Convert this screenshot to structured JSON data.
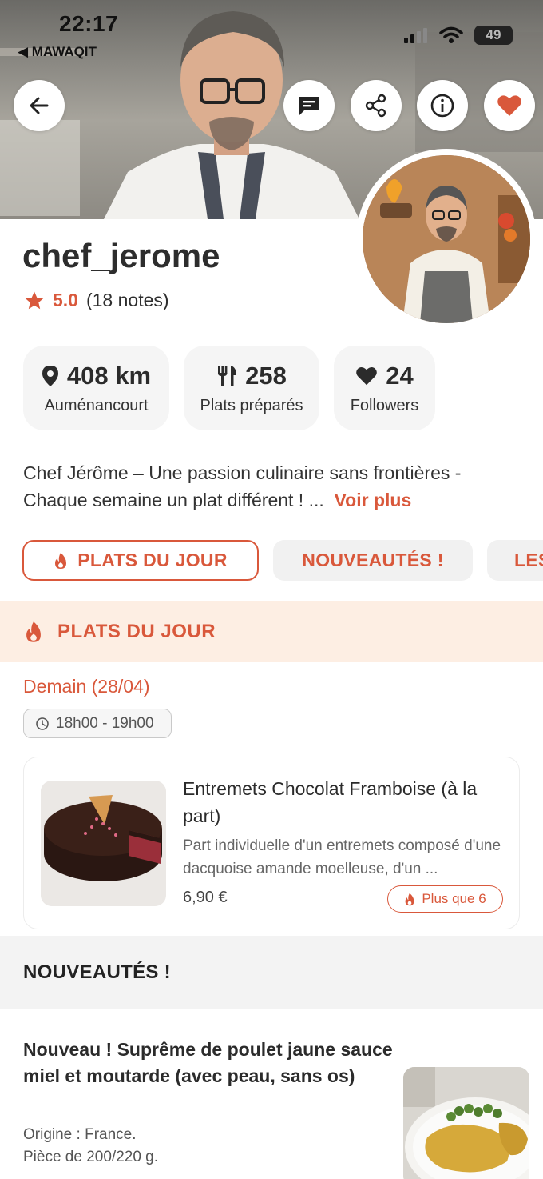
{
  "status_bar": {
    "time": "22:17",
    "back_app": "◀ MAWAQIT",
    "battery": "49"
  },
  "profile": {
    "username": "chef_jerome",
    "rating_score": "5.0",
    "rating_count": "(18 notes)"
  },
  "stats": [
    {
      "icon": "location-pin-icon",
      "value": "408 km",
      "label": "Auménancourt"
    },
    {
      "icon": "fork-knife-icon",
      "value": "258",
      "label": "Plats préparés"
    },
    {
      "icon": "heart-icon",
      "value": "24",
      "label": "Followers"
    }
  ],
  "bio": {
    "text": "Chef Jérôme – Une passion culinaire sans frontières - Chaque semaine un plat différent ! ...",
    "more": "Voir plus"
  },
  "tabs": [
    {
      "label": "PLATS DU JOUR",
      "active": true
    },
    {
      "label": "NOUVEAUTÉS !",
      "active": false
    },
    {
      "label": "LES",
      "active": false
    }
  ],
  "plats_du_jour": {
    "title": "PLATS DU JOUR",
    "date": "Demain (28/04)",
    "time_slot": "18h00 - 19h00",
    "item": {
      "name": "Entremets Chocolat Framboise (à la part)",
      "description": "Part individuelle d'un entremets composé d'une dacquoise amande moelleuse, d'un ...",
      "price": "6,90 €",
      "badge": "Plus que 6"
    }
  },
  "nouveautes": {
    "title": "NOUVEAUTÉS !",
    "item": {
      "name": "Nouveau ! Suprême de poulet jaune sauce miel et moutarde (avec peau, sans os)",
      "description_line1": "Origine : France.",
      "description_line2": "Pièce de 200/220 g."
    }
  },
  "colors": {
    "accent": "#d9583b",
    "section_band": "#fdeee3",
    "chip_bg": "#f5f5f5"
  }
}
